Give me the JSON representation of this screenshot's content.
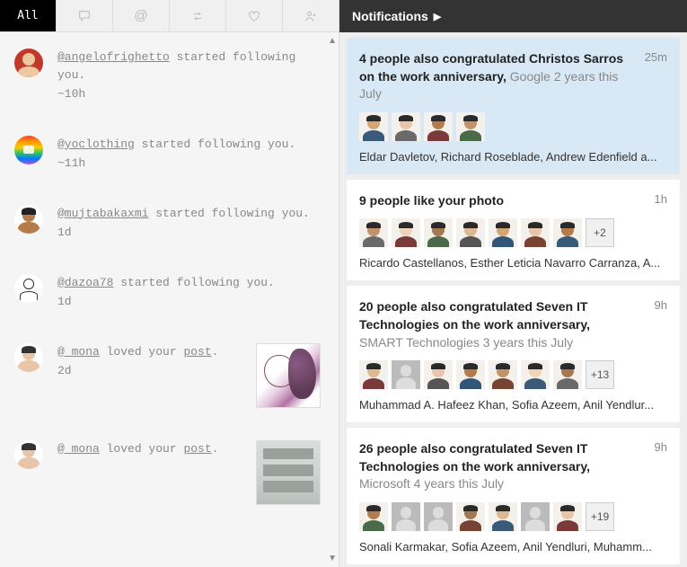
{
  "tabs": {
    "all_label": "All"
  },
  "feed": [
    {
      "user": "@angelofrighetto",
      "action": "started following you.",
      "time": "~10h",
      "avatar": {
        "bg": "#c0392b",
        "skin": "#f0c8a0"
      }
    },
    {
      "user": "@yoclothing",
      "action": "started following you.",
      "time": "~11h",
      "avatar": {
        "rainbow": true
      }
    },
    {
      "user": "@mujtabakaxmi",
      "action": "started following you.",
      "time": "1d",
      "avatar": {
        "bg": "#fff",
        "skin": "#b57b4a",
        "hair": "#222"
      }
    },
    {
      "user": "@dazoa78",
      "action": "started following you.",
      "time": "1d",
      "avatar": {
        "bg": "#fff",
        "sketch": true
      }
    },
    {
      "user": "@_mona",
      "action_pre": "loved your ",
      "action_link": "post",
      "action_post": ".",
      "time": "2d",
      "avatar": {
        "bg": "#fff",
        "skin": "#e8c5a8",
        "hair": "#333"
      },
      "thumb": "illustration"
    },
    {
      "user": "@_mona",
      "action_pre": "loved your ",
      "action_link": "post",
      "action_post": ".",
      "time": "",
      "avatar": {
        "bg": "#fff",
        "skin": "#e8c5a8",
        "hair": "#333"
      },
      "thumb": "photo"
    }
  ],
  "right": {
    "header": "Notifications",
    "items": [
      {
        "highlight": true,
        "title_bold": "4 people also congratulated Christos Sarros on the work anniversary,",
        "title_muted": " Google 2 years this July",
        "time": "25m",
        "avatars": 4,
        "more": null,
        "names": "Eldar Davletov, Richard Roseblade, Andrew Edenfield a..."
      },
      {
        "title_bold": "9 people like your photo",
        "title_muted": "",
        "time": "1h",
        "avatars": 7,
        "more": "+2",
        "names": "Ricardo Castellanos, Esther Leticia Navarro Carranza, A..."
      },
      {
        "title_bold": "20 people also congratulated Seven IT Technologies on the work anniversary,",
        "title_muted": " SMART Technologies 3 years this July",
        "time": "9h",
        "avatars": 7,
        "more": "+13",
        "names": "Muhammad A. Hafeez Khan, Sofia Azeem, Anil Yendlur..."
      },
      {
        "title_bold": "26 people also congratulated Seven IT Technologies on the work anniversary,",
        "title_muted": " Microsoft 4 years this July",
        "time": "9h",
        "avatars": 7,
        "more": "+19",
        "names": "Sonali Karmakar, Sofia Azeem, Anil Yendluri, Muhamm..."
      }
    ]
  },
  "avatar_palette": [
    "#d4a574",
    "#e8c5a8",
    "#b57b4a",
    "#c49268",
    "#f0d4b8",
    "#a67850",
    "#ddb890"
  ]
}
